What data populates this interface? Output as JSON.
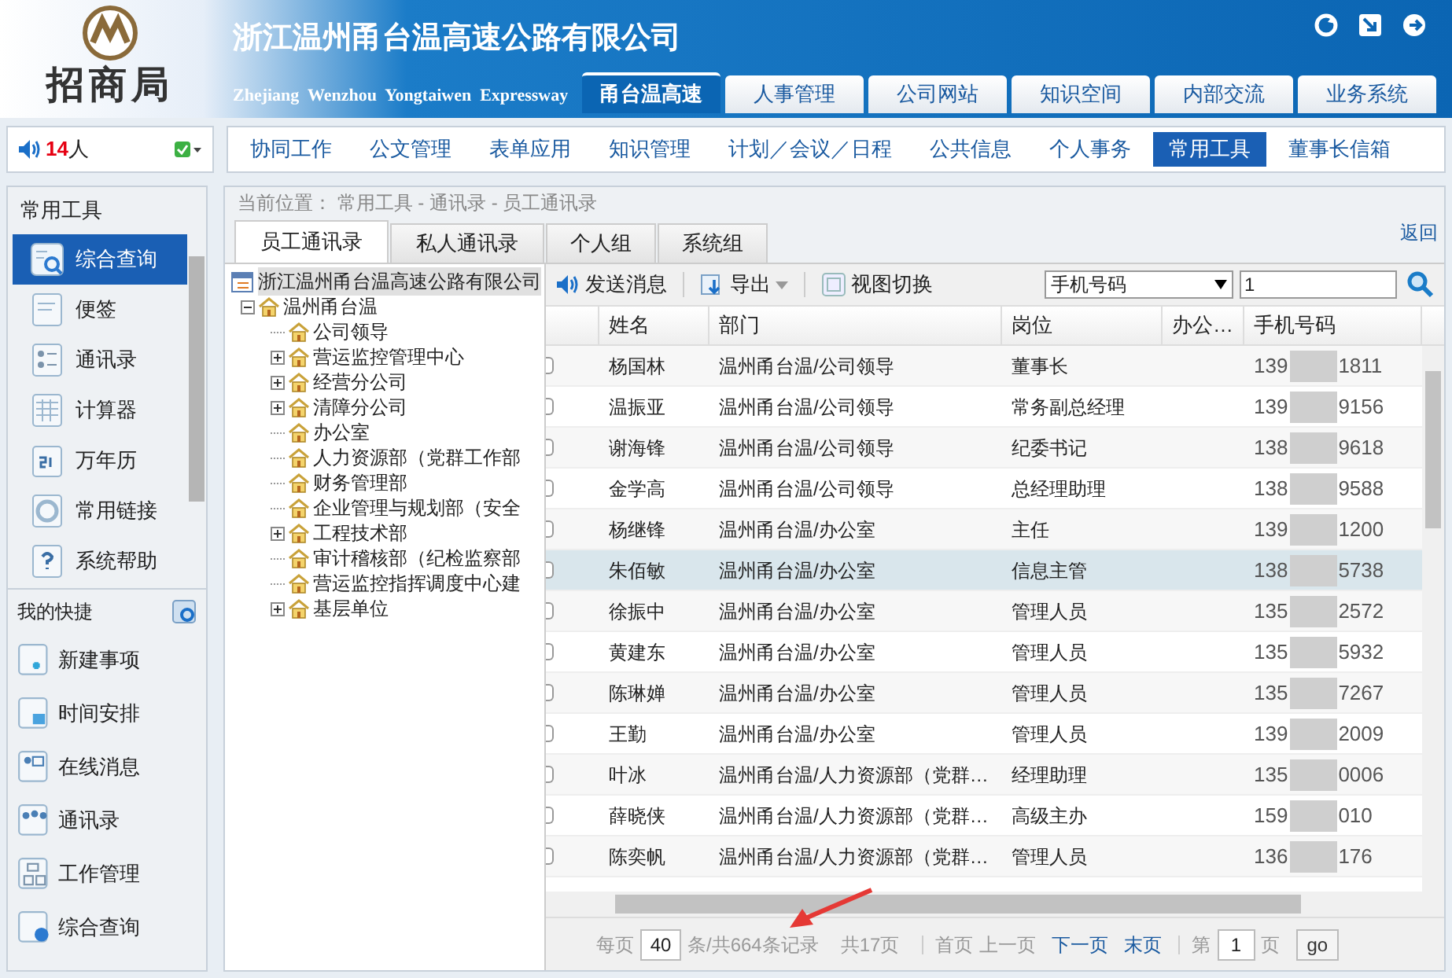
{
  "header": {
    "logo_text": "招商局",
    "company": "浙江温州甬台温高速公路有限公司",
    "company_en": "Zhejiang  Wenzhou  Yongtaiwen  Expressway",
    "top_tabs": [
      {
        "label": "甬台温高速",
        "selected": true
      },
      {
        "label": "人事管理",
        "selected": false
      },
      {
        "label": "公司网站",
        "selected": false
      },
      {
        "label": "知识空间",
        "selected": false
      },
      {
        "label": "内部交流",
        "selected": false
      },
      {
        "label": "业务系统",
        "selected": false
      }
    ]
  },
  "online": {
    "count": "14",
    "unit": "人"
  },
  "menu": [
    {
      "label": "协同工作",
      "selected": false
    },
    {
      "label": "公文管理",
      "selected": false
    },
    {
      "label": "表单应用",
      "selected": false
    },
    {
      "label": "知识管理",
      "selected": false
    },
    {
      "label": "计划／会议／日程",
      "selected": false
    },
    {
      "label": "公共信息",
      "selected": false
    },
    {
      "label": "个人事务",
      "selected": false
    },
    {
      "label": "常用工具",
      "selected": true
    },
    {
      "label": "董事长信箱",
      "selected": false
    }
  ],
  "sidebar": {
    "title": "常用工具",
    "items": [
      {
        "label": "综合查询",
        "selected": true
      },
      {
        "label": "便签",
        "selected": false
      },
      {
        "label": "通讯录",
        "selected": false
      },
      {
        "label": "计算器",
        "selected": false
      },
      {
        "label": "万年历",
        "selected": false
      },
      {
        "label": "常用链接",
        "selected": false
      },
      {
        "label": "系统帮助",
        "selected": false
      }
    ],
    "shortcuts_title": "我的快捷",
    "shortcuts": [
      "新建事项",
      "时间安排",
      "在线消息",
      "通讯录",
      "工作管理",
      "综合查询"
    ]
  },
  "breadcrumb": "当前位置： 常用工具 - 通讯录 - 员工通讯录",
  "back": "返回",
  "tabs": [
    {
      "label": "员工通讯录",
      "selected": true
    },
    {
      "label": "私人通讯录",
      "selected": false
    },
    {
      "label": "个人组",
      "selected": false
    },
    {
      "label": "系统组",
      "selected": false
    }
  ],
  "tree": {
    "label": "浙江温州甬台温高速公路有限公司",
    "selected": true,
    "children": [
      {
        "label": "温州甬台温",
        "expanded": true,
        "selected": false,
        "children": [
          {
            "label": "公司领导",
            "expandable": false
          },
          {
            "label": "营运监控管理中心",
            "expandable": true
          },
          {
            "label": "经营分公司",
            "expandable": true
          },
          {
            "label": "清障分公司",
            "expandable": true
          },
          {
            "label": "办公室",
            "expandable": false
          },
          {
            "label": "人力资源部（党群工作部",
            "expandable": false
          },
          {
            "label": "财务管理部",
            "expandable": false
          },
          {
            "label": "企业管理与规划部（安全",
            "expandable": false
          },
          {
            "label": "工程技术部",
            "expandable": true
          },
          {
            "label": "审计稽核部（纪检监察部",
            "expandable": false
          },
          {
            "label": "营运监控指挥调度中心建",
            "expandable": false
          },
          {
            "label": "基层单位",
            "expandable": true
          }
        ]
      }
    ]
  },
  "toolbar": {
    "send": "发送消息",
    "export": "导出",
    "view": "视图切换",
    "search_field": "手机号码",
    "search_value": "1"
  },
  "table": {
    "columns": [
      "姓名",
      "部门",
      "岗位",
      "办公…",
      "手机号码"
    ],
    "rows": [
      {
        "name": "杨国林",
        "dept": "温州甬台温/公司领导",
        "post": "董事长",
        "phone_start": "139",
        "phone_end": "1811",
        "selected": false
      },
      {
        "name": "温振亚",
        "dept": "温州甬台温/公司领导",
        "post": "常务副总经理",
        "phone_start": "139",
        "phone_end": "9156",
        "selected": false
      },
      {
        "name": "谢海锋",
        "dept": "温州甬台温/公司领导",
        "post": "纪委书记",
        "phone_start": "138",
        "phone_end": "9618",
        "selected": false
      },
      {
        "name": "金学高",
        "dept": "温州甬台温/公司领导",
        "post": "总经理助理",
        "phone_start": "138",
        "phone_end": "9588",
        "selected": false
      },
      {
        "name": "杨继锋",
        "dept": "温州甬台温/办公室",
        "post": "主任",
        "phone_start": "139",
        "phone_end": "1200",
        "selected": false
      },
      {
        "name": "朱佰敏",
        "dept": "温州甬台温/办公室",
        "post": "信息主管",
        "phone_start": "138",
        "phone_end": "5738",
        "selected": true
      },
      {
        "name": "徐振中",
        "dept": "温州甬台温/办公室",
        "post": "管理人员",
        "phone_start": "135",
        "phone_end": "2572",
        "selected": false
      },
      {
        "name": "黄建东",
        "dept": "温州甬台温/办公室",
        "post": "管理人员",
        "phone_start": "135",
        "phone_end": "5932",
        "selected": false
      },
      {
        "name": "陈琳婵",
        "dept": "温州甬台温/办公室",
        "post": "管理人员",
        "phone_start": "135",
        "phone_end": "7267",
        "selected": false
      },
      {
        "name": "王勤",
        "dept": "温州甬台温/办公室",
        "post": "管理人员",
        "phone_start": "139",
        "phone_end": "2009",
        "selected": false
      },
      {
        "name": "叶冰",
        "dept": "温州甬台温/人力资源部（党群…",
        "post": "经理助理",
        "phone_start": "135",
        "phone_end": "0006",
        "selected": false
      },
      {
        "name": "薛晓侠",
        "dept": "温州甬台温/人力资源部（党群…",
        "post": "高级主办",
        "phone_start": "159",
        "phone_end": "010",
        "selected": false
      },
      {
        "name": "陈奕帆",
        "dept": "温州甬台温/人力资源部（党群…",
        "post": "管理人员",
        "phone_start": "136",
        "phone_end": "176",
        "selected": false
      }
    ]
  },
  "pager": {
    "per_page_label": "每页",
    "per_page": "40",
    "records": "条/共664条记录",
    "pages": "共17页",
    "first": "首页",
    "prev": "上一页",
    "next": "下一页",
    "last": "末页",
    "page_prefix": "第",
    "page": "1",
    "page_suffix": "页",
    "go": "go"
  }
}
